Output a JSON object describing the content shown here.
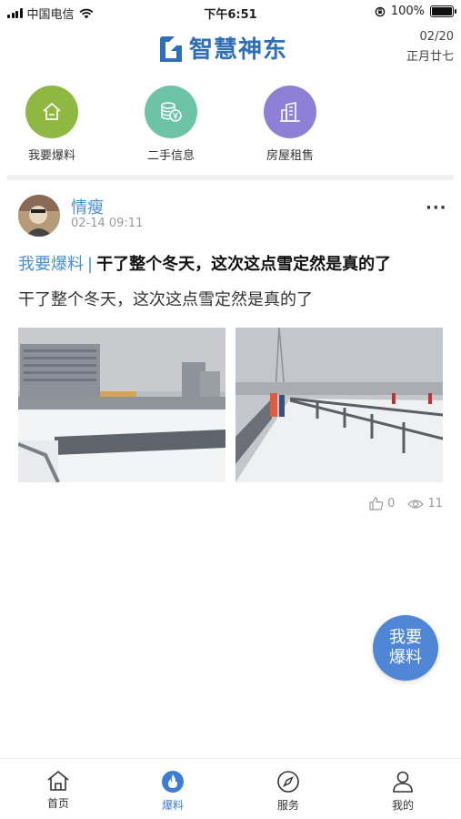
{
  "status_bar": {
    "carrier": "中国电信",
    "time": "下午6:51",
    "battery": "100%",
    "battery_level": 1.0
  },
  "header": {
    "app_title": "智慧神东",
    "date": "02/20",
    "lunar_date": "正月廿七"
  },
  "quick_nav": [
    {
      "label": "我要爆料",
      "icon": "home-icon",
      "color": "#8fb843"
    },
    {
      "label": "二手信息",
      "icon": "coins-yen-icon",
      "color": "#6cc3a6"
    },
    {
      "label": "房屋租售",
      "icon": "building-icon",
      "color": "#8d7fd6"
    }
  ],
  "post": {
    "username": "情瘦",
    "time": "02-14 09:11",
    "category": "我要爆料",
    "separator": "|",
    "title": "干了整个冬天，这次这点雪定然是真的了",
    "body": "干了整个冬天，这次这点雪定然是真的了",
    "likes": "0",
    "views": "11"
  },
  "fab": {
    "line1": "我要",
    "line2": "爆料"
  },
  "tabbar": [
    {
      "label": "首页",
      "icon": "home-outline-icon",
      "active": false
    },
    {
      "label": "爆料",
      "icon": "flame-icon",
      "active": true
    },
    {
      "label": "服务",
      "icon": "compass-icon",
      "active": false
    },
    {
      "label": "我的",
      "icon": "person-icon",
      "active": false
    }
  ],
  "colors": {
    "accent": "#4a8fd0",
    "tab_active": "#3b7dd6",
    "fab": "#4f86d6"
  }
}
